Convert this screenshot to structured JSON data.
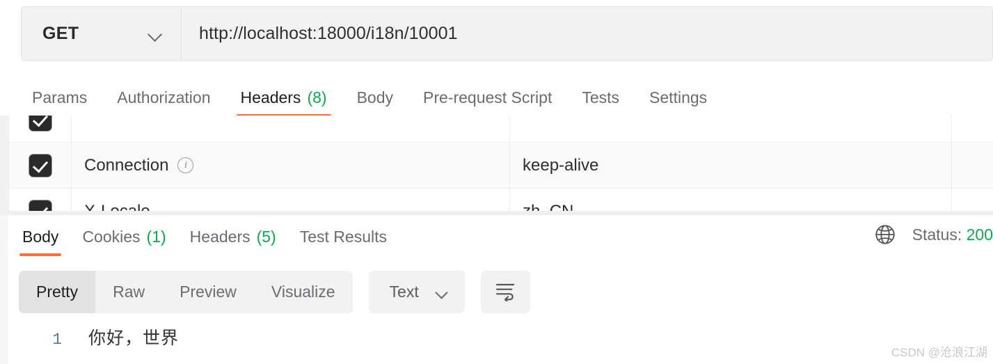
{
  "request": {
    "method": "GET",
    "method_dropdown_icon": "chevron-down-icon",
    "url": "http://localhost:18000/i18n/10001",
    "tabs": [
      {
        "label": "Params",
        "count": "",
        "active": false
      },
      {
        "label": "Authorization",
        "count": "",
        "active": false
      },
      {
        "label": "Headers",
        "count": "(8)",
        "active": true
      },
      {
        "label": "Body",
        "count": "",
        "active": false
      },
      {
        "label": "Pre-request Script",
        "count": "",
        "active": false
      },
      {
        "label": "Tests",
        "count": "",
        "active": false
      },
      {
        "label": "Settings",
        "count": "",
        "active": false
      }
    ],
    "headers_table": {
      "rows": [
        {
          "checked": true,
          "key": "Connection",
          "has_info_icon": true,
          "value": "keep-alive",
          "description": ""
        },
        {
          "checked": true,
          "key": "X-Locale",
          "has_info_icon": false,
          "value": "zh_CN",
          "description": ""
        }
      ]
    }
  },
  "response": {
    "tabs": [
      {
        "label": "Body",
        "count": "",
        "active": true
      },
      {
        "label": "Cookies",
        "count": "(1)",
        "active": false
      },
      {
        "label": "Headers",
        "count": "(5)",
        "active": false
      },
      {
        "label": "Test Results",
        "count": "",
        "active": false
      }
    ],
    "status": {
      "icon": "globe-icon",
      "label": "Status:",
      "code": "200"
    },
    "format_tabs": [
      {
        "label": "Pretty",
        "active": true
      },
      {
        "label": "Raw",
        "active": false
      },
      {
        "label": "Preview",
        "active": false
      },
      {
        "label": "Visualize",
        "active": false
      }
    ],
    "language_dropdown": {
      "value": "Text",
      "icon": "chevron-down-icon"
    },
    "wrap_button_icon": "word-wrap-icon",
    "body_lines": [
      {
        "number": "1",
        "text": "你好，世界"
      }
    ]
  },
  "watermark": "CSDN @沧浪江湖",
  "colors": {
    "accent_orange": "#ff6c37",
    "count_green": "#0bab4e",
    "bar_bg": "#f2f2f2"
  }
}
